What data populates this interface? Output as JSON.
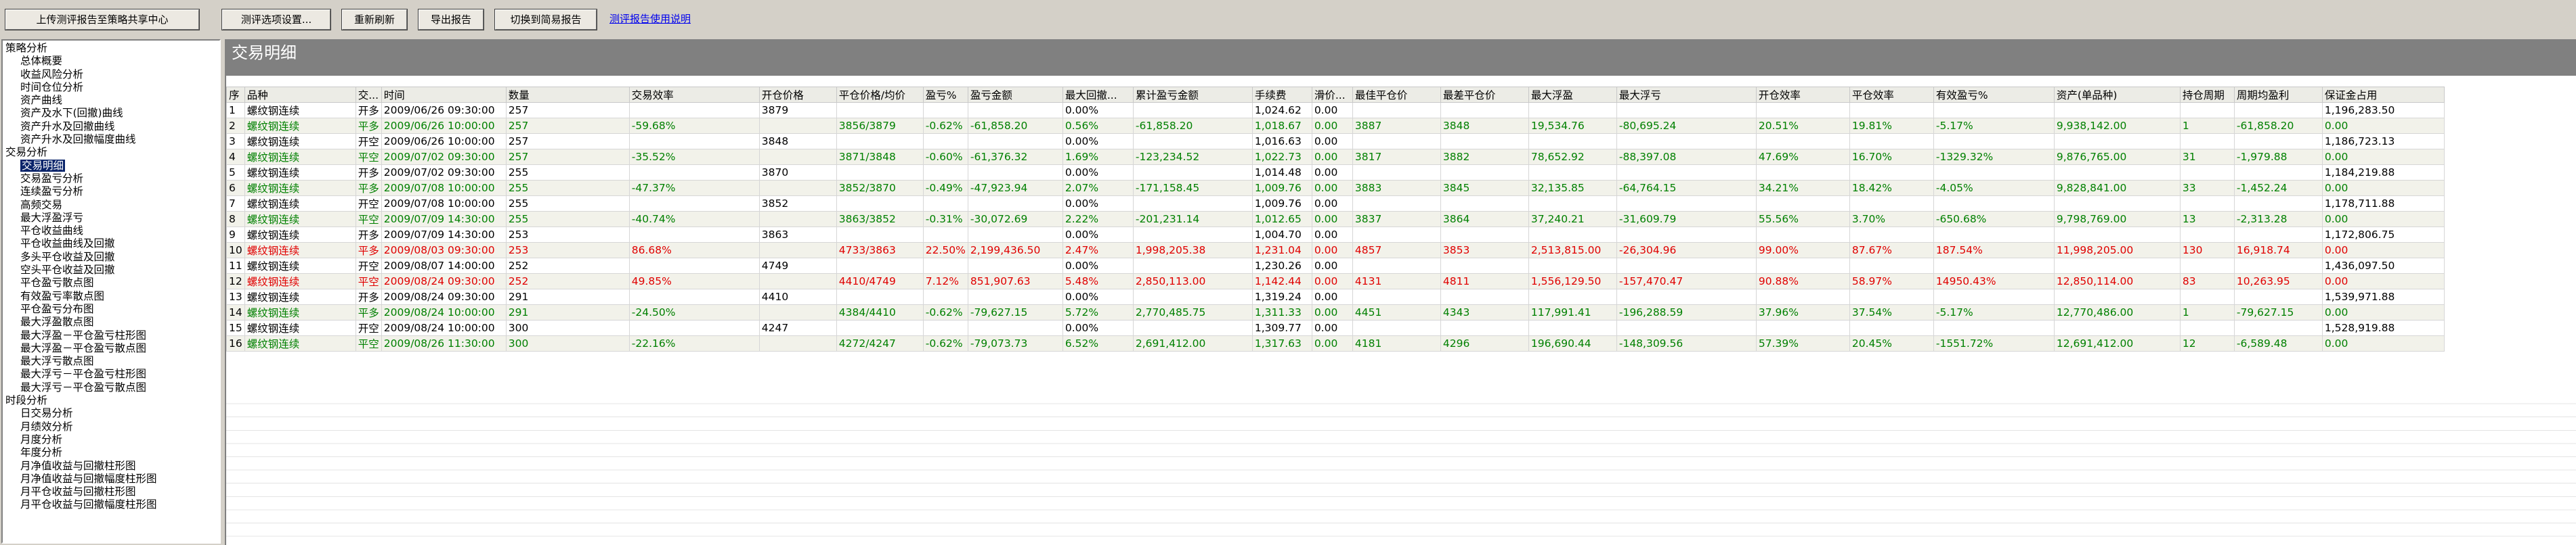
{
  "toolbar": {
    "upload": "上传测评报告至策略共享中心",
    "settings": "测评选项设置...",
    "refresh": "重新刷新",
    "export": "导出报告",
    "simple": "切换到简易报告",
    "help_link": "测评报告使用说明"
  },
  "tree": [
    {
      "label": "策略分析",
      "level": 0
    },
    {
      "label": "总体概要",
      "level": 1
    },
    {
      "label": "收益风险分析",
      "level": 1
    },
    {
      "label": "时间仓位分析",
      "level": 1
    },
    {
      "label": "资产曲线",
      "level": 1
    },
    {
      "label": "资产及水下(回撤)曲线",
      "level": 1
    },
    {
      "label": "资产升水及回撤曲线",
      "level": 1
    },
    {
      "label": "资产升水及回撤幅度曲线",
      "level": 1
    },
    {
      "label": "交易分析",
      "level": 0
    },
    {
      "label": "交易明细",
      "level": 1,
      "selected": true
    },
    {
      "label": "交易盈亏分析",
      "level": 1
    },
    {
      "label": "连续盈亏分析",
      "level": 1
    },
    {
      "label": "高频交易",
      "level": 1
    },
    {
      "label": "最大浮盈浮亏",
      "level": 1
    },
    {
      "label": "平仓收益曲线",
      "level": 1
    },
    {
      "label": "平仓收益曲线及回撤",
      "level": 1
    },
    {
      "label": "多头平仓收益及回撤",
      "level": 1
    },
    {
      "label": "空头平仓收益及回撤",
      "level": 1
    },
    {
      "label": "平仓盈亏散点图",
      "level": 1
    },
    {
      "label": "有效盈亏率散点图",
      "level": 1
    },
    {
      "label": "平仓盈亏分布图",
      "level": 1
    },
    {
      "label": "最大浮盈散点图",
      "level": 1
    },
    {
      "label": "最大浮盈－平仓盈亏柱形图",
      "level": 1
    },
    {
      "label": "最大浮盈－平仓盈亏散点图",
      "level": 1
    },
    {
      "label": "最大浮亏散点图",
      "level": 1
    },
    {
      "label": "最大浮亏－平仓盈亏柱形图",
      "level": 1
    },
    {
      "label": "最大浮亏－平仓盈亏散点图",
      "level": 1
    },
    {
      "label": "时段分析",
      "level": 0
    },
    {
      "label": "日交易分析",
      "level": 1
    },
    {
      "label": "月绩效分析",
      "level": 1
    },
    {
      "label": "月度分析",
      "level": 1
    },
    {
      "label": "年度分析",
      "level": 1
    },
    {
      "label": "月净值收益与回撤柱形图",
      "level": 1
    },
    {
      "label": "月净值收益与回撤幅度柱形图",
      "level": 1
    },
    {
      "label": "月平仓收益与回撤柱形图",
      "level": 1
    },
    {
      "label": "月平仓收益与回撤幅度柱形图",
      "level": 1
    }
  ],
  "panel_title": "交易明细",
  "columns": [
    "序",
    "品种",
    "交...",
    "时间",
    "数量",
    "交易效率",
    "开仓价格",
    "平仓价格/均价",
    "盈亏%",
    "盈亏金额",
    "最大回撤...",
    "累计盈亏金额",
    "手续费",
    "滑价...",
    "最佳平仓价",
    "最差平仓价",
    "最大浮盈",
    "最大浮亏",
    "开仓效率",
    "平仓效率",
    "有效盈亏%",
    "资产(单品种)",
    "持仓周期",
    "周期均盈利",
    "保证金占用"
  ],
  "rows": [
    [
      "1",
      "螺纹钢连续",
      "开多",
      "2009/06/26 09:30:00",
      "257",
      "",
      "3879",
      "",
      "",
      "",
      "0.00%",
      "",
      "1,024.62",
      "0.00",
      "",
      "",
      "",
      "",
      "",
      "",
      "",
      "",
      "",
      "",
      "1,196,283.50"
    ],
    [
      "2",
      "螺纹钢连续",
      "平多",
      "2009/06/26 10:00:00",
      "257",
      "-59.68%",
      "",
      "3856/3879",
      "-0.62%",
      "-61,858.20",
      "0.56%",
      "-61,858.20",
      "1,018.67",
      "0.00",
      "3887",
      "3848",
      "19,534.76",
      "-80,695.24",
      "20.51%",
      "19.81%",
      "-5.17%",
      "9,938,142.00",
      "1",
      "-61,858.20",
      "0.00"
    ],
    [
      "3",
      "螺纹钢连续",
      "开空",
      "2009/06/26 10:00:00",
      "257",
      "",
      "3848",
      "",
      "",
      "",
      "0.00%",
      "",
      "1,016.63",
      "0.00",
      "",
      "",
      "",
      "",
      "",
      "",
      "",
      "",
      "",
      "",
      "1,186,723.13"
    ],
    [
      "4",
      "螺纹钢连续",
      "平空",
      "2009/07/02 09:30:00",
      "257",
      "-35.52%",
      "",
      "3871/3848",
      "-0.60%",
      "-61,376.32",
      "1.69%",
      "-123,234.52",
      "1,022.73",
      "0.00",
      "3817",
      "3882",
      "78,652.92",
      "-88,397.08",
      "47.69%",
      "16.70%",
      "-1329.32%",
      "9,876,765.00",
      "31",
      "-1,979.88",
      "0.00"
    ],
    [
      "5",
      "螺纹钢连续",
      "开多",
      "2009/07/02 09:30:00",
      "255",
      "",
      "3870",
      "",
      "",
      "",
      "0.00%",
      "",
      "1,014.48",
      "0.00",
      "",
      "",
      "",
      "",
      "",
      "",
      "",
      "",
      "",
      "",
      "1,184,219.88"
    ],
    [
      "6",
      "螺纹钢连续",
      "平多",
      "2009/07/08 10:00:00",
      "255",
      "-47.37%",
      "",
      "3852/3870",
      "-0.49%",
      "-47,923.94",
      "2.07%",
      "-171,158.45",
      "1,009.76",
      "0.00",
      "3883",
      "3845",
      "32,135.85",
      "-64,764.15",
      "34.21%",
      "18.42%",
      "-4.05%",
      "9,828,841.00",
      "33",
      "-1,452.24",
      "0.00"
    ],
    [
      "7",
      "螺纹钢连续",
      "开空",
      "2009/07/08 10:00:00",
      "255",
      "",
      "3852",
      "",
      "",
      "",
      "0.00%",
      "",
      "1,009.76",
      "0.00",
      "",
      "",
      "",
      "",
      "",
      "",
      "",
      "",
      "",
      "",
      "1,178,711.88"
    ],
    [
      "8",
      "螺纹钢连续",
      "平空",
      "2009/07/09 14:30:00",
      "255",
      "-40.74%",
      "",
      "3863/3852",
      "-0.31%",
      "-30,072.69",
      "2.22%",
      "-201,231.14",
      "1,012.65",
      "0.00",
      "3837",
      "3864",
      "37,240.21",
      "-31,609.79",
      "55.56%",
      "3.70%",
      "-650.68%",
      "9,798,769.00",
      "13",
      "-2,313.28",
      "0.00"
    ],
    [
      "9",
      "螺纹钢连续",
      "开多",
      "2009/07/09 14:30:00",
      "253",
      "",
      "3863",
      "",
      "",
      "",
      "0.00%",
      "",
      "1,004.70",
      "0.00",
      "",
      "",
      "",
      "",
      "",
      "",
      "",
      "",
      "",
      "",
      "1,172,806.75"
    ],
    [
      "10",
      "螺纹钢连续",
      "平多",
      "2009/08/03 09:30:00",
      "253",
      "86.68%",
      "",
      "4733/3863",
      "22.50%",
      "2,199,436.50",
      "2.47%",
      "1,998,205.38",
      "1,231.04",
      "0.00",
      "4857",
      "3853",
      "2,513,815.00",
      "-26,304.96",
      "99.00%",
      "87.67%",
      "187.54%",
      "11,998,205.00",
      "130",
      "16,918.74",
      "0.00"
    ],
    [
      "11",
      "螺纹钢连续",
      "开空",
      "2009/08/07 14:00:00",
      "252",
      "",
      "4749",
      "",
      "",
      "",
      "0.00%",
      "",
      "1,230.26",
      "0.00",
      "",
      "",
      "",
      "",
      "",
      "",
      "",
      "",
      "",
      "",
      "1,436,097.50"
    ],
    [
      "12",
      "螺纹钢连续",
      "平空",
      "2009/08/24 09:30:00",
      "252",
      "49.85%",
      "",
      "4410/4749",
      "7.12%",
      "851,907.63",
      "5.48%",
      "2,850,113.00",
      "1,142.44",
      "0.00",
      "4131",
      "4811",
      "1,556,129.50",
      "-157,470.47",
      "90.88%",
      "58.97%",
      "14950.43%",
      "12,850,114.00",
      "83",
      "10,263.95",
      "0.00"
    ],
    [
      "13",
      "螺纹钢连续",
      "开多",
      "2009/08/24 09:30:00",
      "291",
      "",
      "4410",
      "",
      "",
      "",
      "0.00%",
      "",
      "1,319.24",
      "0.00",
      "",
      "",
      "",
      "",
      "",
      "",
      "",
      "",
      "",
      "",
      "1,539,971.88"
    ],
    [
      "14",
      "螺纹钢连续",
      "平多",
      "2009/08/24 10:00:00",
      "291",
      "-24.50%",
      "",
      "4384/4410",
      "-0.62%",
      "-79,627.15",
      "5.72%",
      "2,770,485.75",
      "1,311.33",
      "0.00",
      "4451",
      "4343",
      "117,991.41",
      "-196,288.59",
      "37.96%",
      "37.54%",
      "-5.17%",
      "12,770,486.00",
      "1",
      "-79,627.15",
      "0.00"
    ],
    [
      "15",
      "螺纹钢连续",
      "开空",
      "2009/08/24 10:00:00",
      "300",
      "",
      "4247",
      "",
      "",
      "",
      "0.00%",
      "",
      "1,309.77",
      "0.00",
      "",
      "",
      "",
      "",
      "",
      "",
      "",
      "",
      "",
      "",
      "1,528,919.88"
    ],
    [
      "16",
      "螺纹钢连续",
      "平空",
      "2009/08/26 11:30:00",
      "300",
      "-22.16%",
      "",
      "4272/4247",
      "-0.62%",
      "-79,073.73",
      "6.52%",
      "2,691,412.00",
      "1,317.63",
      "0.00",
      "4181",
      "4296",
      "196,690.44",
      "-148,309.56",
      "57.39%",
      "20.45%",
      "-1551.72%",
      "12,691,412.00",
      "12",
      "-6,589.48",
      "0.00"
    ]
  ],
  "colors": {
    "profit": "#e00000",
    "loss": "#008000",
    "open": "#000000",
    "selection": "#0a246a"
  }
}
